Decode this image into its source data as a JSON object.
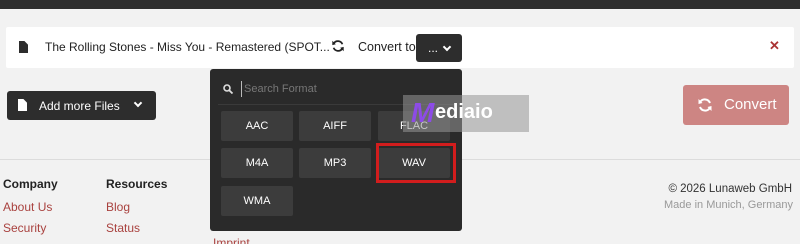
{
  "file_row": {
    "filename": "The Rolling Stones - Miss You - Remastered (SPOT...",
    "convert_to_label": "Convert to",
    "selected_format": "..."
  },
  "actions": {
    "add_more_files": "Add more Files",
    "convert": "Convert"
  },
  "dropdown": {
    "search_placeholder": "Search Format",
    "formats": [
      "AAC",
      "AIFF",
      "FLAC",
      "M4A",
      "MP3",
      "WAV",
      "WMA"
    ],
    "highlighted_format": "WAV"
  },
  "footer": {
    "company_heading": "Company",
    "company_links": [
      "About Us",
      "Security"
    ],
    "resources_heading": "Resources",
    "resources_links": [
      "Blog",
      "Status"
    ],
    "imprint": "Imprint",
    "copyright": "© 2026 Lunaweb GmbH",
    "made_in": "Made in Munich, Germany"
  },
  "watermark": {
    "text": "ediaio",
    "letter": "M"
  },
  "colors": {
    "dark": "#2d2d2d",
    "accent_red": "#a9423f",
    "convert_button": "#cd8583",
    "highlight_box": "#d21d1d"
  }
}
